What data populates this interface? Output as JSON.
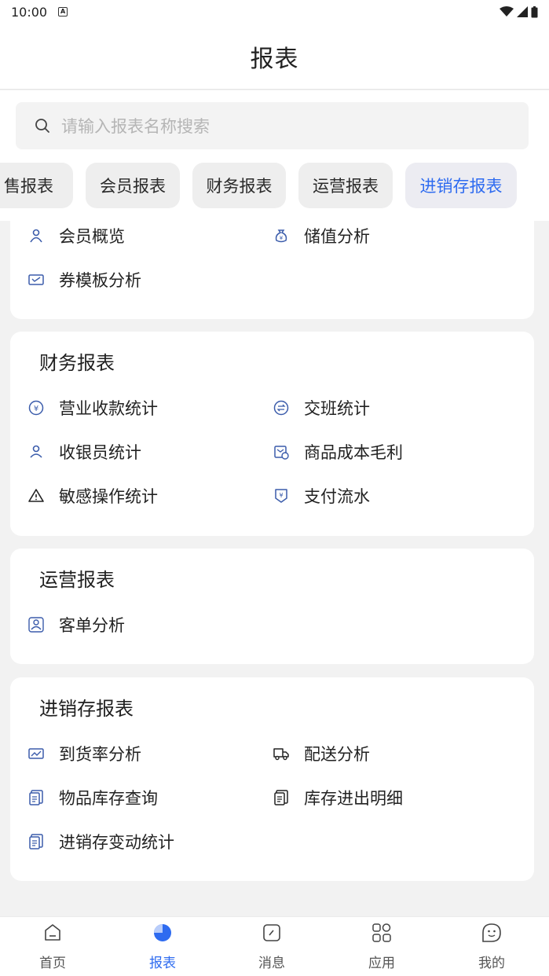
{
  "status": {
    "time": "10:00",
    "notif_glyph": "A"
  },
  "header": {
    "title": "报表"
  },
  "search": {
    "placeholder": "请输入报表名称搜索"
  },
  "chips": [
    {
      "label": "售报表"
    },
    {
      "label": "会员报表"
    },
    {
      "label": "财务报表"
    },
    {
      "label": "运营报表"
    },
    {
      "label": "进销存报表",
      "active": true
    }
  ],
  "sections": {
    "member": {
      "items": [
        {
          "label": "会员概览",
          "icon": "member-icon"
        },
        {
          "label": "储值分析",
          "icon": "money-bag-icon"
        },
        {
          "label": "券模板分析",
          "icon": "coupon-icon"
        }
      ]
    },
    "finance": {
      "title": "财务报表",
      "items": [
        {
          "label": "营业收款统计",
          "icon": "yen-circle-icon"
        },
        {
          "label": "交班统计",
          "icon": "exchange-icon"
        },
        {
          "label": "收银员统计",
          "icon": "cashier-icon"
        },
        {
          "label": "商品成本毛利",
          "icon": "cost-profit-icon"
        },
        {
          "label": "敏感操作统计",
          "icon": "warning-icon"
        },
        {
          "label": "支付流水",
          "icon": "payment-flow-icon"
        }
      ]
    },
    "operation": {
      "title": "运营报表",
      "items": [
        {
          "label": "客单分析",
          "icon": "customer-icon"
        }
      ]
    },
    "inventory": {
      "title": "进销存报表",
      "items": [
        {
          "label": "到货率分析",
          "icon": "truck-chart-icon"
        },
        {
          "label": "配送分析",
          "icon": "truck-icon"
        },
        {
          "label": "物品库存查询",
          "icon": "inventory-doc-icon"
        },
        {
          "label": "库存进出明细",
          "icon": "inventory-doc-icon"
        },
        {
          "label": "进销存变动统计",
          "icon": "inventory-doc-icon"
        }
      ]
    }
  },
  "tabbar": [
    {
      "label": "首页",
      "icon": "home-icon"
    },
    {
      "label": "报表",
      "icon": "report-icon",
      "active": true
    },
    {
      "label": "消息",
      "icon": "message-icon"
    },
    {
      "label": "应用",
      "icon": "apps-icon"
    },
    {
      "label": "我的",
      "icon": "profile-icon"
    }
  ],
  "colors": {
    "accent": "#2e6bf0",
    "icon_blue": "#3b5cab",
    "background": "#f2f2f2"
  }
}
